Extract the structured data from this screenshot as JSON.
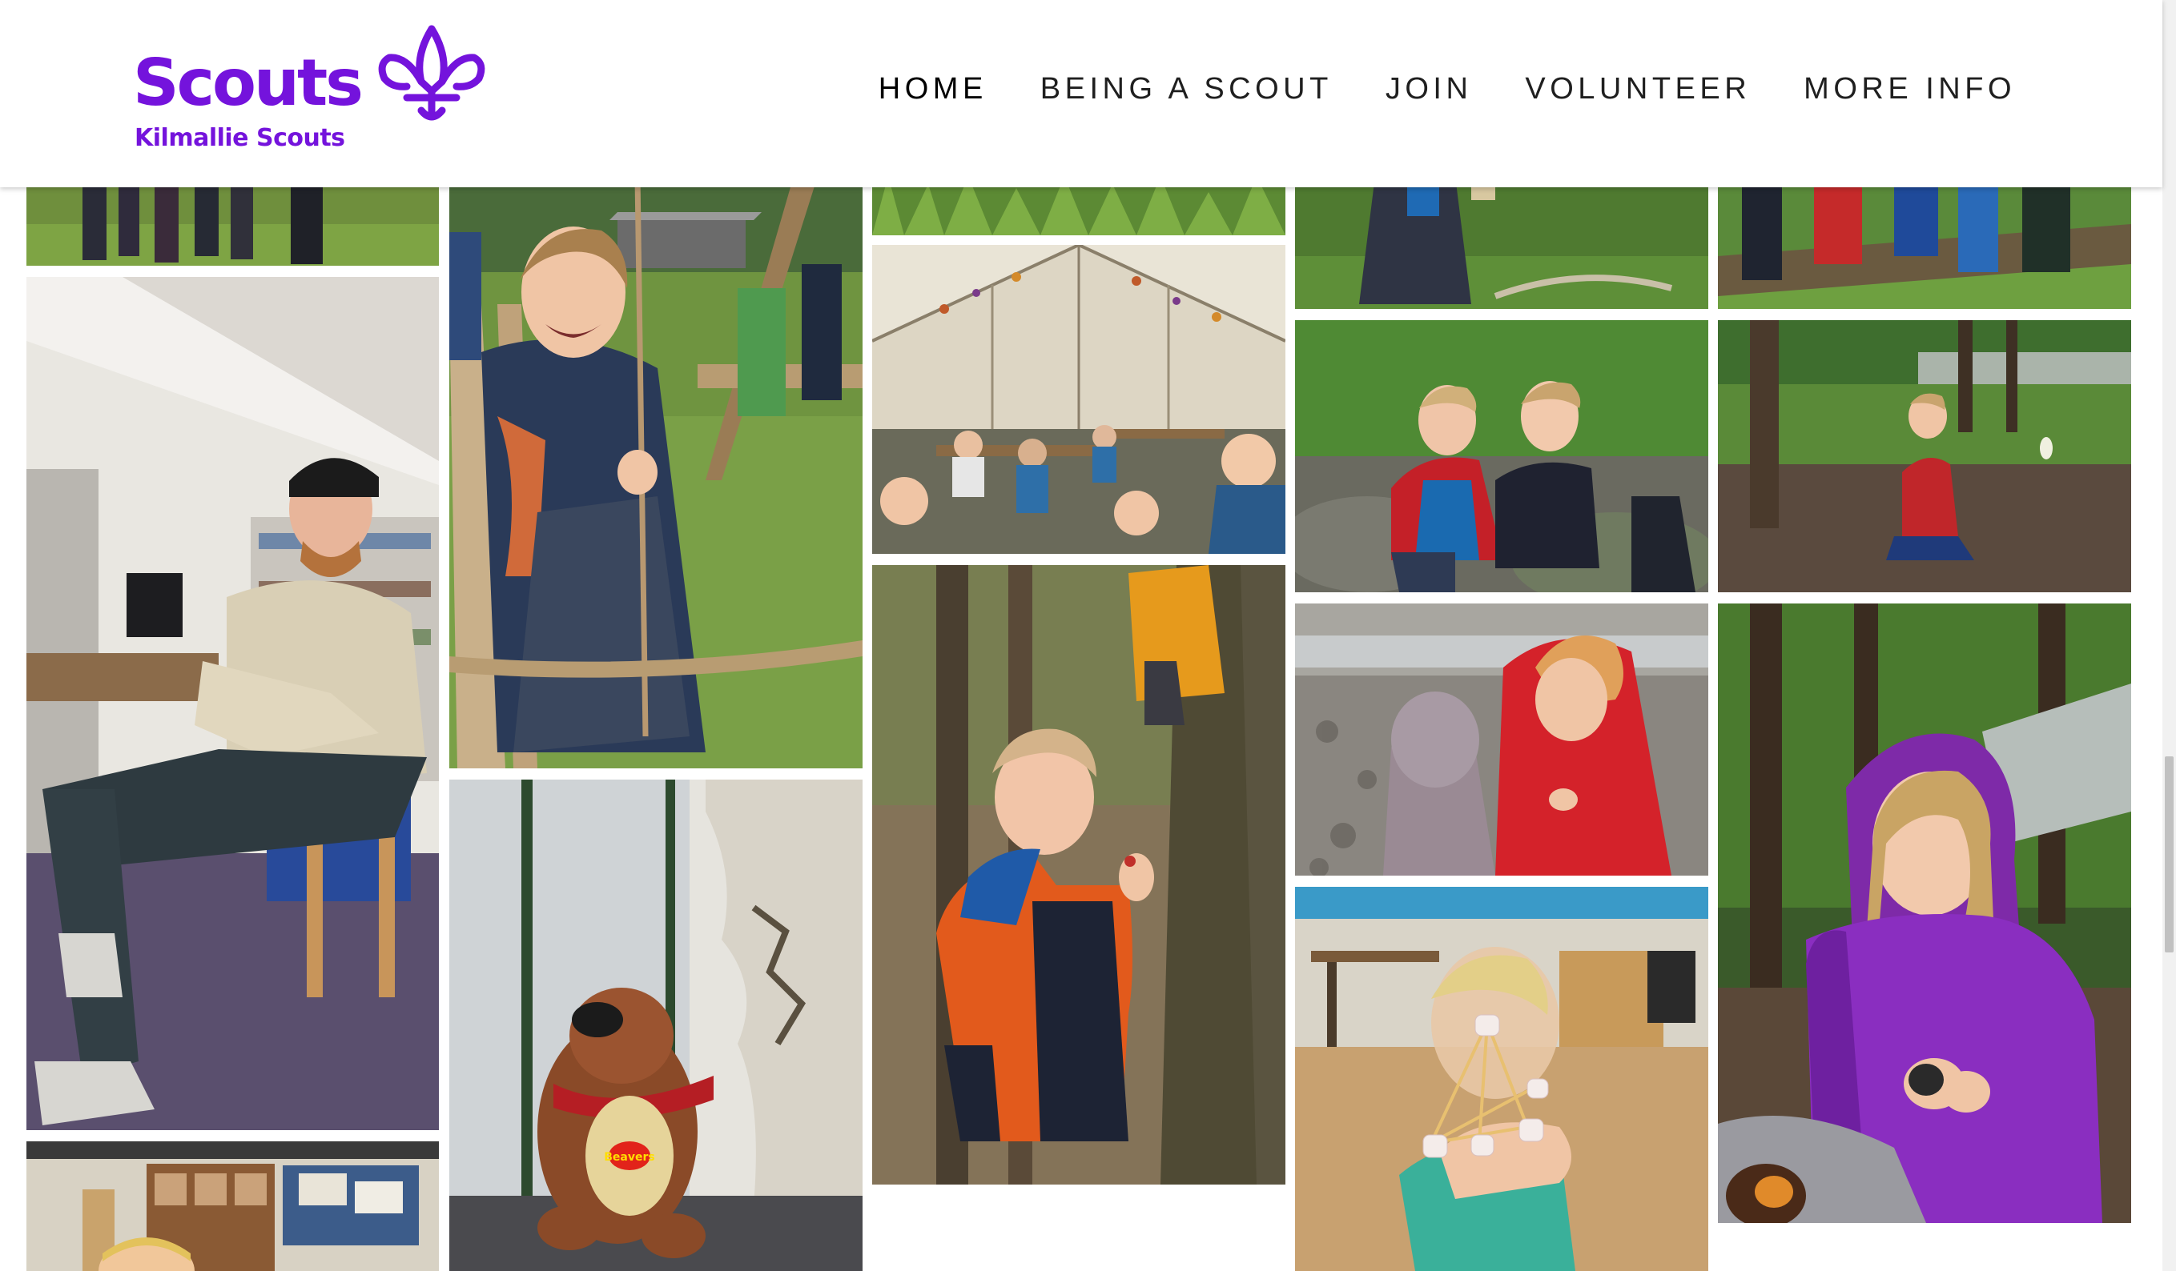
{
  "site": {
    "logo_word": "Scouts",
    "logo_sub": "Kilmallie Scouts",
    "brand_color": "#7413dc"
  },
  "nav": {
    "home": "HOME",
    "being_a_scout": "BEING A SCOUT",
    "join": "JOIN",
    "volunteer": "VOLUNTEER",
    "more_info": "MORE INFO"
  },
  "gallery": {
    "photos": [
      "Scouts on grass (partially cropped top)",
      "Leader in scout uniform sitting in library",
      "Hall with scout (cropped bottom)",
      "Boy smiling on rope swing",
      "Teddy bear in scout neckerchief by pillar",
      "Grass strip (cropped top)",
      "Scouts eating in large tent",
      "Boy in orange jacket in forest",
      "Scout among trees (cropped top)",
      "Two boys sitting on mossy rocks",
      "Leader and child looking at pebbles by river",
      "Boy holding marshmallow and spaghetti structure",
      "Scouts on fallen log (cropped top)",
      "Child kneeling on riverbank",
      "Girl in purple coat at campfire"
    ],
    "sticker_text": "Beavers"
  }
}
